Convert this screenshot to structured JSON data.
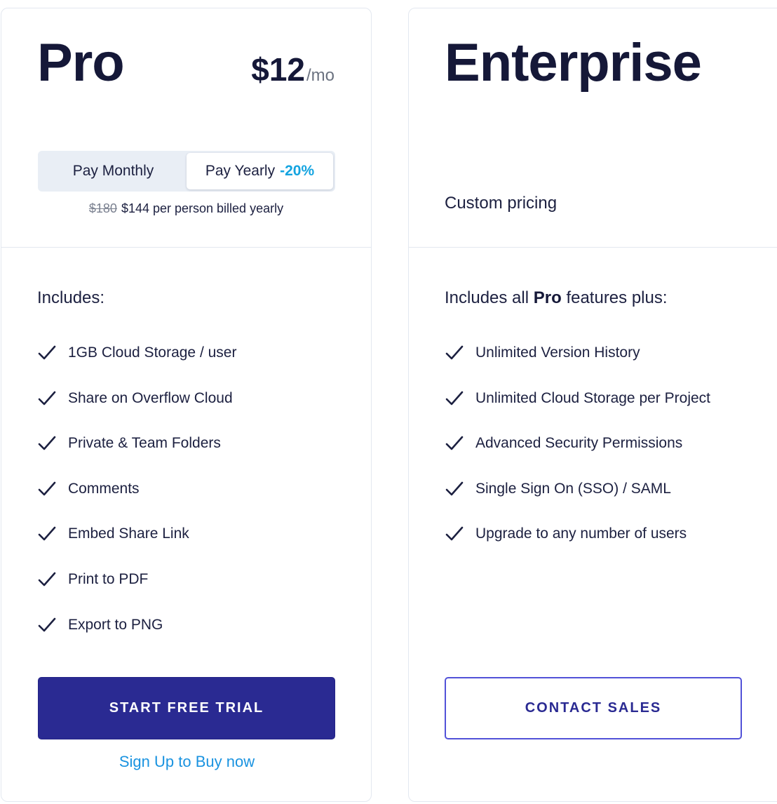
{
  "plans": {
    "pro": {
      "name": "Pro",
      "price": "$12",
      "price_period": "/mo",
      "billing_toggle": {
        "monthly_label": "Pay Monthly",
        "yearly_label": "Pay Yearly",
        "yearly_discount": "-20%",
        "selected": "yearly"
      },
      "billing_note": {
        "old_price": "$180",
        "new_price_text": "$144 per person billed yearly"
      },
      "includes_label": "Includes:",
      "features": [
        "1GB Cloud Storage / user",
        "Share on Overflow Cloud",
        "Private & Team Folders",
        "Comments",
        "Embed Share Link",
        "Print to PDF",
        "Export to PNG"
      ],
      "cta_label": "START FREE TRIAL",
      "secondary_link": "Sign Up to Buy now"
    },
    "enterprise": {
      "name": "Enterprise",
      "pricing_text": "Custom pricing",
      "includes_prefix": "Includes all",
      "includes_bold": "Pro",
      "includes_suffix": "features plus:",
      "features": [
        "Unlimited Version History",
        "Unlimited Cloud Storage per Project",
        "Advanced Security Permissions",
        "Single Sign On (SSO) / SAML",
        "Upgrade to any number of users"
      ],
      "cta_label": "CONTACT SALES"
    }
  },
  "colors": {
    "primary": "#2a2a92",
    "accent_blue": "#14a4e0",
    "link_blue": "#1a93e0",
    "text_dark": "#151838",
    "border": "#e3e8f0"
  }
}
